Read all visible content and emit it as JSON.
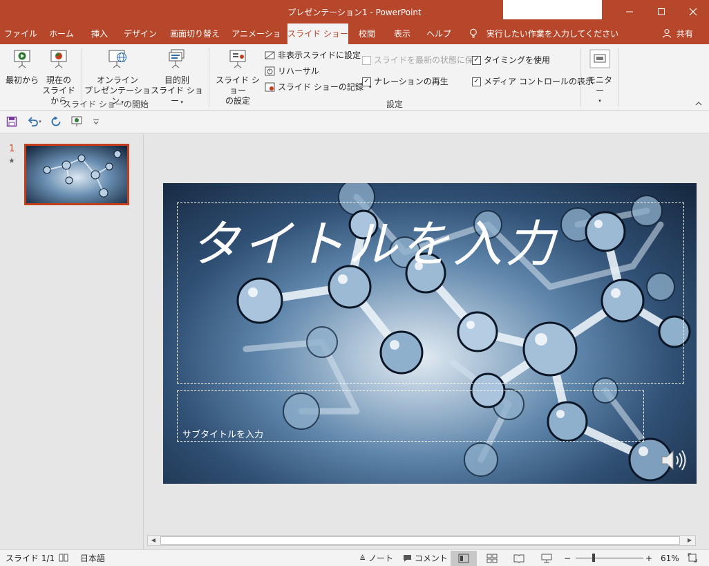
{
  "window": {
    "title": "プレゼンテーション1 - PowerPoint",
    "minimize_icon": "minimize-icon",
    "maximize_icon": "maximize-icon",
    "close_icon": "close-icon"
  },
  "tabs": [
    {
      "label": "ファイル"
    },
    {
      "label": "ホーム"
    },
    {
      "label": "挿入"
    },
    {
      "label": "デザイン"
    },
    {
      "label": "画面切り替え"
    },
    {
      "label": "アニメーション"
    },
    {
      "label": "スライド ショー",
      "active": true
    },
    {
      "label": "校閲"
    },
    {
      "label": "表示"
    },
    {
      "label": "ヘルプ"
    }
  ],
  "tell_me": "実行したい作業を入力してください",
  "share": "共有",
  "ribbon": {
    "start_group": {
      "label": "スライド ショーの開始",
      "from_beginning": "最初から",
      "from_current_1": "現在の",
      "from_current_2": "スライドから",
      "online_1": "オンライン",
      "online_2": "プレゼンテーション",
      "custom_1": "目的別",
      "custom_2": "スライド ショー"
    },
    "setup_group": {
      "label": "設定",
      "setup_1": "スライド ショー",
      "setup_2": "の設定",
      "hide_slide": "非表示スライドに設定",
      "rehearse": "リハーサル",
      "record": "スライド ショーの記録",
      "keep_updated": "スライドを最新の状態に保つ",
      "play_narration": "ナレーションの再生",
      "use_timings": "タイミングを使用",
      "show_media_controls": "メディア コントロールの表示"
    },
    "monitor_group": {
      "monitor": "モニター"
    }
  },
  "checkboxes": {
    "keep_updated": false,
    "play_narration": true,
    "use_timings": true,
    "show_media_controls": true
  },
  "thumbnails": [
    {
      "number": "1",
      "animation_mark": "★"
    }
  ],
  "slide": {
    "title_placeholder": "タイトルを入力",
    "subtitle_placeholder": "サブタイトルを入力"
  },
  "status": {
    "slide_position": "スライド 1/1",
    "language": "日本語",
    "notes": "ノート",
    "comments": "コメント",
    "zoom_minus": "−",
    "zoom_plus": "+",
    "zoom": "61%",
    "zoom_fraction": 0.61
  },
  "colors": {
    "accent": "#b7472a",
    "ribbon_bg": "#f3f3f3",
    "thumb_border": "#c43e1c"
  }
}
